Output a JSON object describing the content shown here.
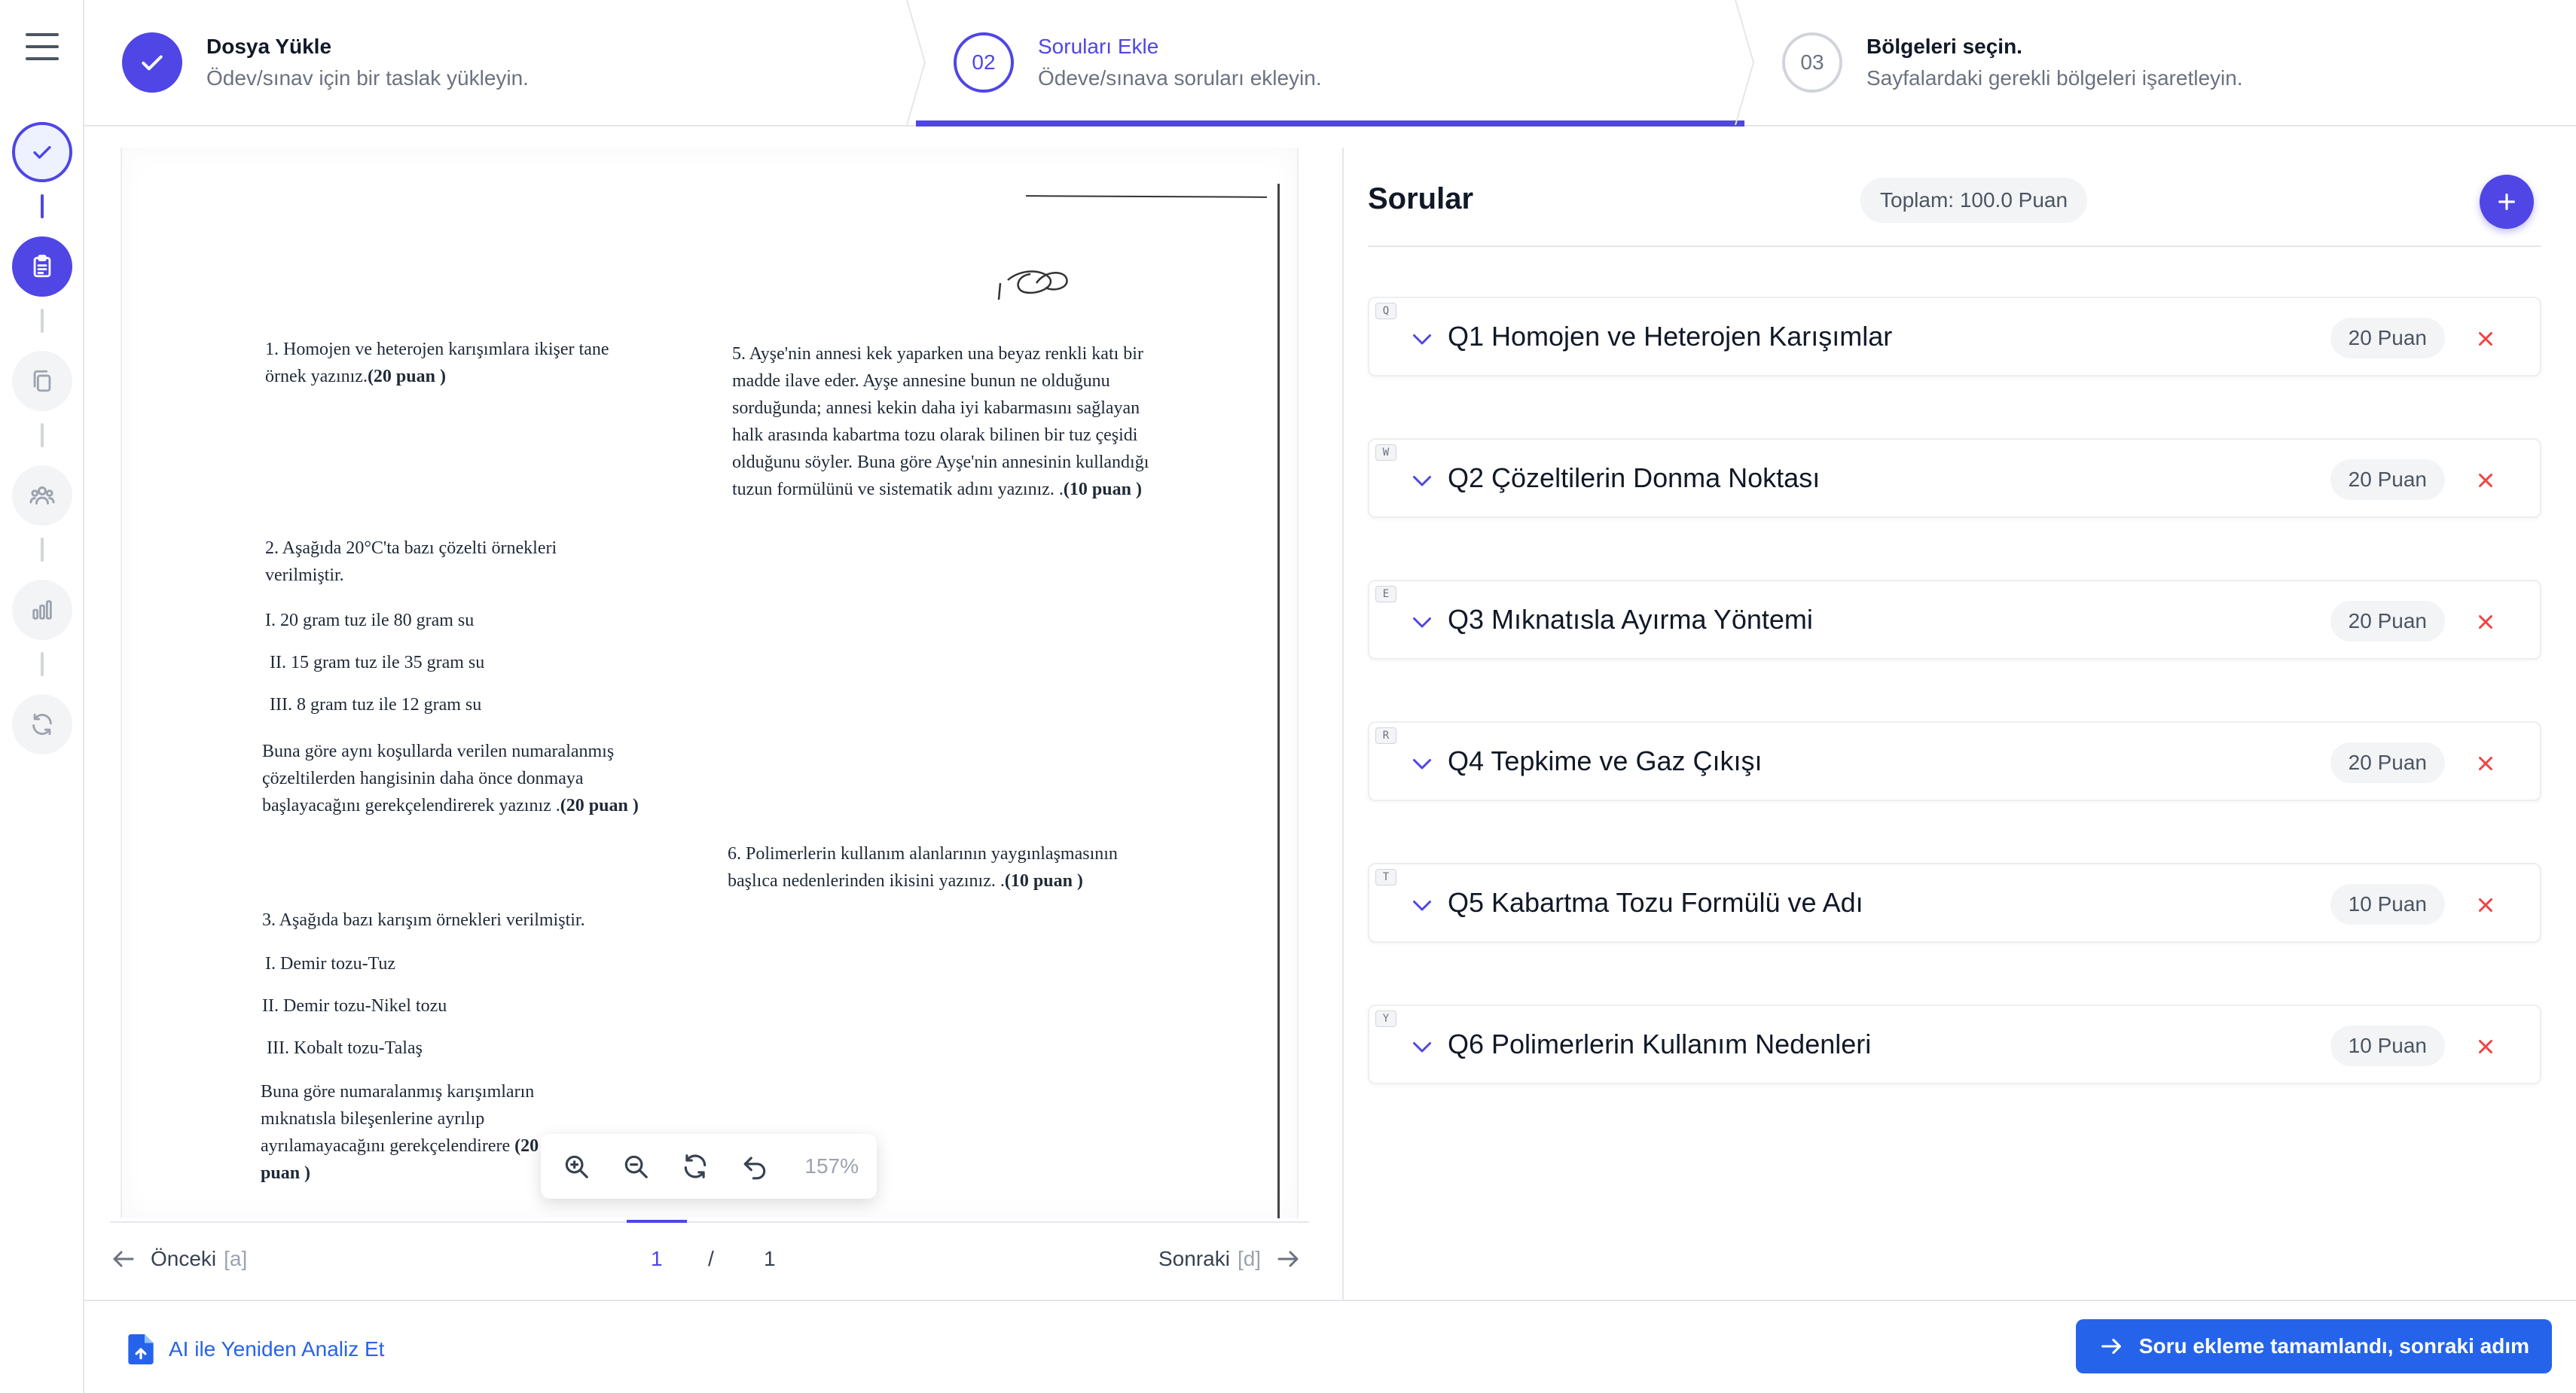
{
  "rail": {
    "icons": [
      "menu-icon",
      "check-icon",
      "clipboard-icon",
      "copy-icon",
      "users-icon",
      "bar-chart-icon",
      "refresh-icon"
    ],
    "accent": "#4f46e5"
  },
  "stepper": {
    "steps": [
      {
        "number": "",
        "title": "Dosya Yükle",
        "subtitle": "Ödev/sınav için bir taslak yükleyin.",
        "state": "done"
      },
      {
        "number": "02",
        "title": "Soruları Ekle",
        "subtitle": "Ödeve/sınava soruları ekleyin.",
        "state": "active"
      },
      {
        "number": "03",
        "title": "Bölgeleri seçin.",
        "subtitle": "Sayfalardaki gerekli bölgeleri işaretleyin.",
        "state": "idle"
      }
    ]
  },
  "document": {
    "q1": {
      "text": "1. Homojen ve heterojen karışımlara ikişer tane örnek yazınız.",
      "points": "(20 puan )"
    },
    "q2": {
      "intro": "2. Aşağıda 20°C'ta bazı çözelti örnekleri verilmiştir.",
      "items": [
        "I. 20 gram tuz ile 80 gram su",
        "II. 15 gram tuz ile 35 gram su",
        "III. 8 gram tuz ile 12 gram su"
      ],
      "prompt": "Buna göre aynı koşullarda verilen numaralanmış çözeltilerden hangisinin daha önce donmaya başlayacağını gerekçelendirerek yazınız .",
      "points": "(20 puan )"
    },
    "q3": {
      "intro": "3. Aşağıda bazı karışım örnekleri verilmiştir.",
      "items": [
        "I. Demir tozu-Tuz",
        "II. Demir tozu-Nikel tozu",
        "III. Kobalt tozu-Talaş"
      ],
      "prompt": "Buna göre numaralanmış karışımların mıknatısla bileşenlerine ayrılıp ayrılamayacağını gerekçelendirere",
      "points": "(20 puan )"
    },
    "q5": {
      "text": "5. Ayşe'nin annesi kek yaparken una beyaz renkli katı bir madde ilave eder. Ayşe annesine bunun ne olduğunu sorduğunda; annesi kekin daha iyi kabarmasını sağlayan halk arasında kabartma tozu olarak bilinen bir tuz çeşidi olduğunu söyler. Buna göre Ayşe'nin annesinin kullandığı tuzun formülünü ve sistematik adını yazınız. .",
      "points": "(10 puan )"
    },
    "q6": {
      "text": "6. Polimerlerin kullanım alanlarının yaygınlaşmasının başlıca nedenlerinden ikisini yazınız. .",
      "points": "(10 puan )"
    }
  },
  "zoom": {
    "label": "157%",
    "icons": [
      "zoom-in-icon",
      "zoom-out-icon",
      "rotate-icon",
      "undo-icon"
    ]
  },
  "pager": {
    "prev_label": "Önceki",
    "prev_key": "[a]",
    "next_label": "Sonraki",
    "next_key": "[d]",
    "current": "1",
    "separator": "/",
    "total": "1"
  },
  "questions": {
    "title": "Sorular",
    "total": "Toplam: 100.0 Puan",
    "items": [
      {
        "key": "Q",
        "title": "Q1 Homojen ve Heterojen Karışımlar",
        "points": "20 Puan"
      },
      {
        "key": "W",
        "title": "Q2 Çözeltilerin Donma Noktası",
        "points": "20 Puan"
      },
      {
        "key": "E",
        "title": "Q3 Mıknatısla Ayırma Yöntemi",
        "points": "20 Puan"
      },
      {
        "key": "R",
        "title": "Q4 Tepkime ve Gaz Çıkışı",
        "points": "20 Puan"
      },
      {
        "key": "T",
        "title": "Q5 Kabartma Tozu Formülü ve Adı",
        "points": "10 Puan"
      },
      {
        "key": "Y",
        "title": "Q6 Polimerlerin Kullanım Nedenleri",
        "points": "10 Puan"
      }
    ]
  },
  "footer": {
    "reanalyze_label": "AI ile Yeniden Analiz Et",
    "next_label": "Soru ekleme tamamlandı, sonraki adım"
  },
  "colors": {
    "accent": "#4f46e5",
    "primary_button": "#2563eb",
    "delete": "#ef4444"
  }
}
